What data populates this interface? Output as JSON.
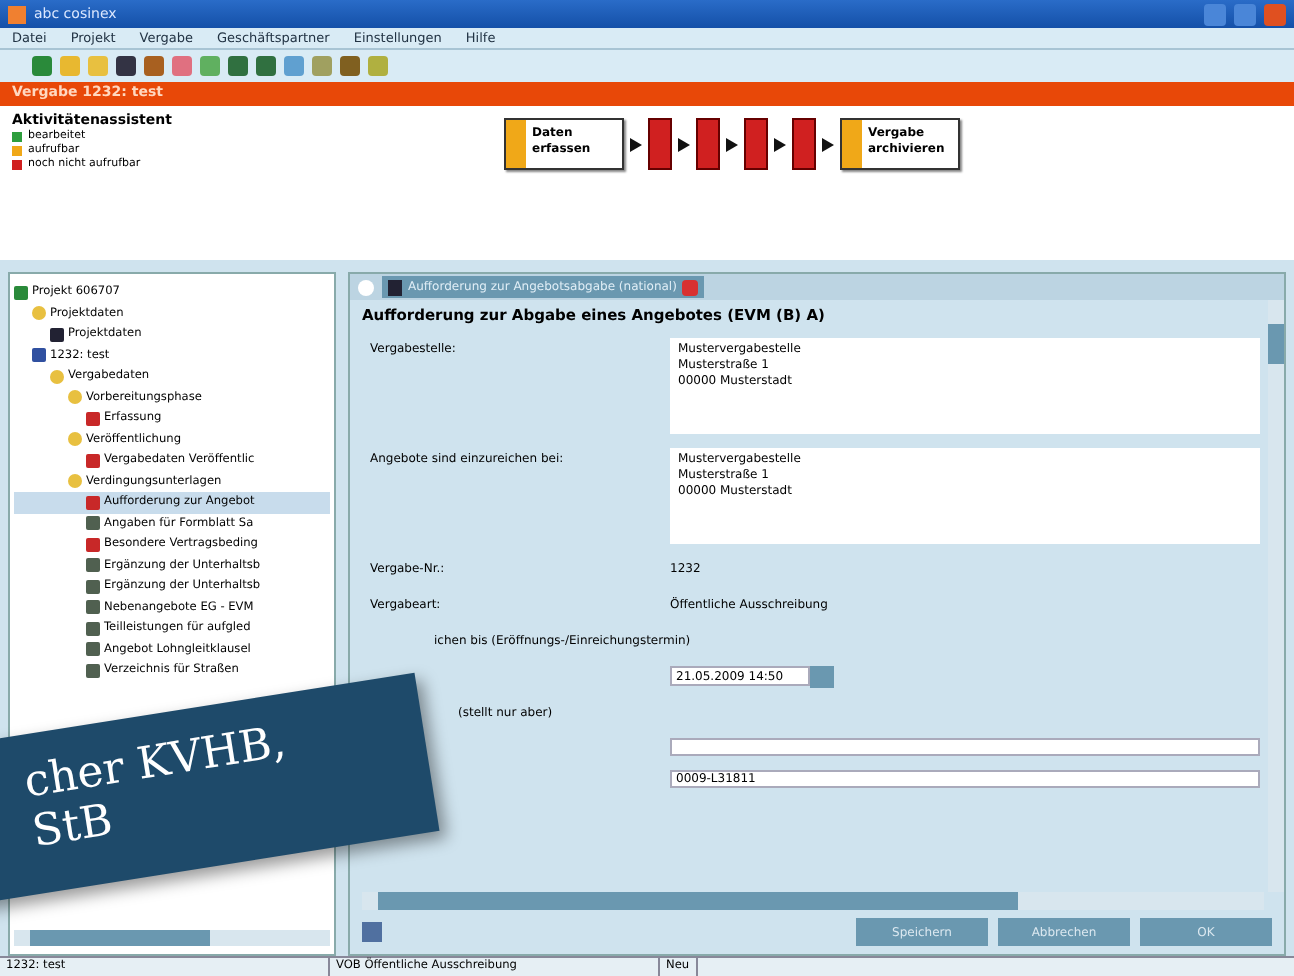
{
  "window": {
    "title": "abc cosinex"
  },
  "menu": [
    "Datei",
    "Projekt",
    "Vergabe",
    "Geschäftspartner",
    "Einstellungen",
    "Hilfe"
  ],
  "vergabe_bar": {
    "title": "Vergabe 1232: test"
  },
  "assistant": {
    "title": "Aktivitätenassistent",
    "legend": [
      {
        "label": "bearbeitet",
        "color": "#2e9e3e"
      },
      {
        "label": "aufrufbar",
        "color": "#f0a818"
      },
      {
        "label": "noch nicht aufrufbar",
        "color": "#d02020"
      }
    ],
    "steps": [
      {
        "label": "Daten erfassen",
        "color": "#f0a818"
      },
      {
        "color": "#d02020"
      },
      {
        "color": "#d02020"
      },
      {
        "color": "#d02020"
      },
      {
        "color": "#d02020"
      },
      {
        "label": "Vergabe archivieren",
        "color": "#f0a818"
      }
    ]
  },
  "tree": [
    {
      "label": "Projekt 606707",
      "kind": "project",
      "selected": false,
      "children": [
        {
          "label": "Projektdaten",
          "kind": "folder",
          "selected": false,
          "children": [
            {
              "label": "Projektdaten",
              "kind": "check",
              "selected": false
            }
          ]
        },
        {
          "label": "1232: test",
          "kind": "disk",
          "selected": false,
          "children": [
            {
              "label": "Vergabedaten",
              "kind": "folder",
              "selected": false,
              "children": [
                {
                  "label": "Vorbereitungsphase",
                  "kind": "folder",
                  "selected": false,
                  "children": [
                    {
                      "label": "Erfassung",
                      "kind": "red",
                      "selected": false
                    }
                  ]
                },
                {
                  "label": "Veröffentlichung",
                  "kind": "folder",
                  "selected": false,
                  "children": [
                    {
                      "label": "Vergabedaten Veröffentlic",
                      "kind": "red",
                      "selected": false
                    }
                  ]
                },
                {
                  "label": "Verdingungsunterlagen",
                  "kind": "folder",
                  "selected": false,
                  "children": [
                    {
                      "label": "Aufforderung zur Angebot",
                      "kind": "red",
                      "selected": true
                    },
                    {
                      "label": "Angaben für Formblatt Sa",
                      "kind": "dark",
                      "selected": false
                    },
                    {
                      "label": "Besondere Vertragsbeding",
                      "kind": "red",
                      "selected": false
                    },
                    {
                      "label": "Ergänzung der Unterhaltsb",
                      "kind": "dark",
                      "selected": false
                    },
                    {
                      "label": "Ergänzung der Unterhaltsb",
                      "kind": "dark",
                      "selected": false
                    },
                    {
                      "label": "Nebenangebote EG - EVM",
                      "kind": "dark",
                      "selected": false
                    },
                    {
                      "label": "Teilleistungen für aufgled",
                      "kind": "dark",
                      "selected": false
                    },
                    {
                      "label": "Angebot Lohngleitklausel",
                      "kind": "dark",
                      "selected": false
                    },
                    {
                      "label": "Verzeichnis für Straßen",
                      "kind": "dark",
                      "selected": false
                    }
                  ]
                }
              ]
            }
          ]
        }
      ]
    }
  ],
  "tab": {
    "label": "Aufforderung zur Angebotsabgabe (national)"
  },
  "form": {
    "heading": "Aufforderung zur Abgabe eines Angebotes (EVM (B) A)",
    "rows": [
      {
        "kind": "area",
        "label": "Vergabestelle:",
        "lines": [
          "Mustervergabestelle",
          "Musterstraße 1",
          "00000 Musterstadt"
        ]
      },
      {
        "kind": "area",
        "label": "Angebote sind einzureichen bei:",
        "lines": [
          "Mustervergabestelle",
          "Musterstraße 1",
          "00000 Musterstadt"
        ]
      },
      {
        "kind": "text",
        "label": "Vergabe-Nr.:",
        "value": "1232"
      },
      {
        "kind": "text",
        "label": "Vergabeart:",
        "value": "Öffentliche Ausschreibung"
      },
      {
        "kind": "heading",
        "label": "ichen bis (Eröffnungs-/Einreichungstermin)"
      },
      {
        "kind": "date",
        "value": "21.05.2009 14:50"
      },
      {
        "kind": "heading",
        "label": "(stellt nur aber)"
      },
      {
        "kind": "input"
      },
      {
        "kind": "input",
        "value": "0009-L31811"
      }
    ]
  },
  "buttons": [
    "Speichern",
    "Abbrechen",
    "OK"
  ],
  "status_bar": [
    "1232: test",
    "VOB Öffentliche Ausschreibung",
    "Neu"
  ],
  "banner": {
    "lines": [
      "cher KVHB,",
      "StB"
    ]
  }
}
